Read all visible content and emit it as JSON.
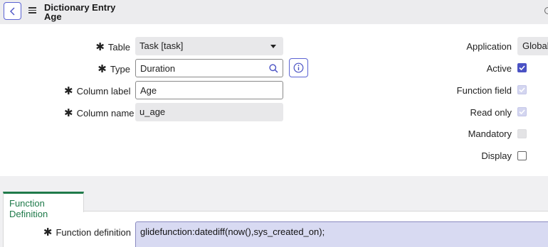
{
  "header": {
    "title_line1": "Dictionary Entry",
    "title_line2": "Age"
  },
  "form": {
    "table": {
      "label": "Table",
      "value": "Task [task]"
    },
    "type": {
      "label": "Type",
      "value": "Duration"
    },
    "column_label": {
      "label": "Column label",
      "value": "Age"
    },
    "column_name": {
      "label": "Column name",
      "value": "u_age"
    }
  },
  "right_panel": {
    "application": {
      "label": "Application",
      "value": "Global"
    },
    "active": {
      "label": "Active",
      "checked": true
    },
    "function_field": {
      "label": "Function field",
      "checked": true
    },
    "read_only": {
      "label": "Read only",
      "checked": true
    },
    "mandatory": {
      "label": "Mandatory",
      "checked": false
    },
    "display": {
      "label": "Display",
      "checked": false
    }
  },
  "tabs": [
    {
      "label": "Function Definition",
      "active": true
    }
  ],
  "function_definition": {
    "label": "Function definition",
    "value": "glidefunction:datediff(now(),sys_created_on);"
  },
  "colors": {
    "accent": "#4a52c4",
    "tab_accent": "#1f7a4a",
    "header_bg": "#ececee"
  }
}
